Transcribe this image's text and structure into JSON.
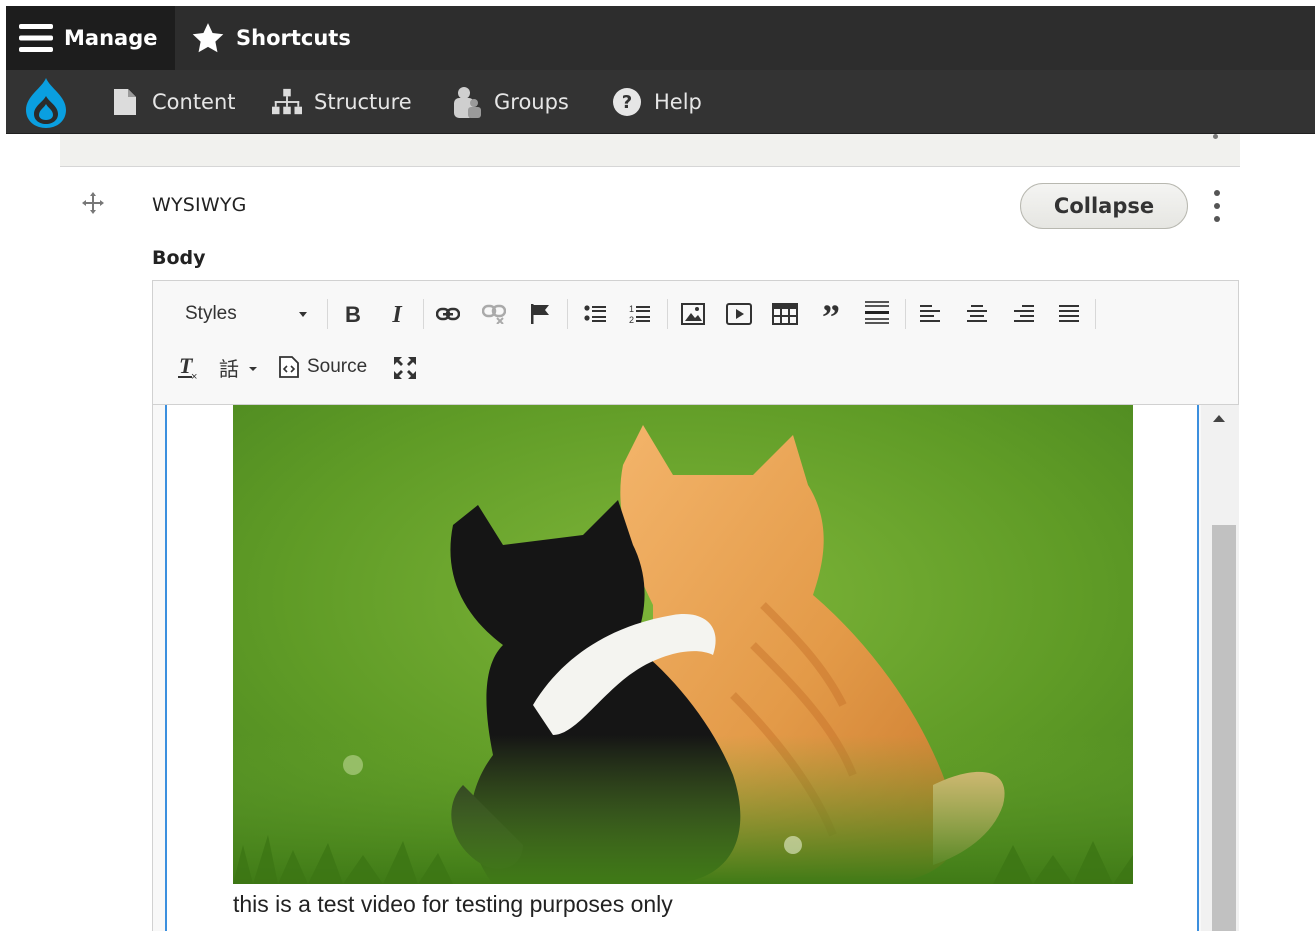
{
  "toolbar_top": {
    "manage_label": "Manage",
    "shortcuts_label": "Shortcuts"
  },
  "nav": {
    "items": [
      {
        "label": "Content",
        "icon": "file-icon"
      },
      {
        "label": "Structure",
        "icon": "sitemap-icon"
      },
      {
        "label": "Groups",
        "icon": "people-icon"
      },
      {
        "label": "Help",
        "icon": "question-icon"
      }
    ]
  },
  "paragraph": {
    "type_label": "WYSIWYG",
    "collapse_label": "Collapse",
    "field_label": "Body"
  },
  "editor": {
    "styles_label": "Styles",
    "source_label": "Source",
    "caption": "this is a test video for testing purposes only"
  },
  "colors": {
    "toolbar_dark": "#2d2d2d",
    "focus_blue": "#3b8fde",
    "drupal_blue": "#0a9fe0"
  }
}
